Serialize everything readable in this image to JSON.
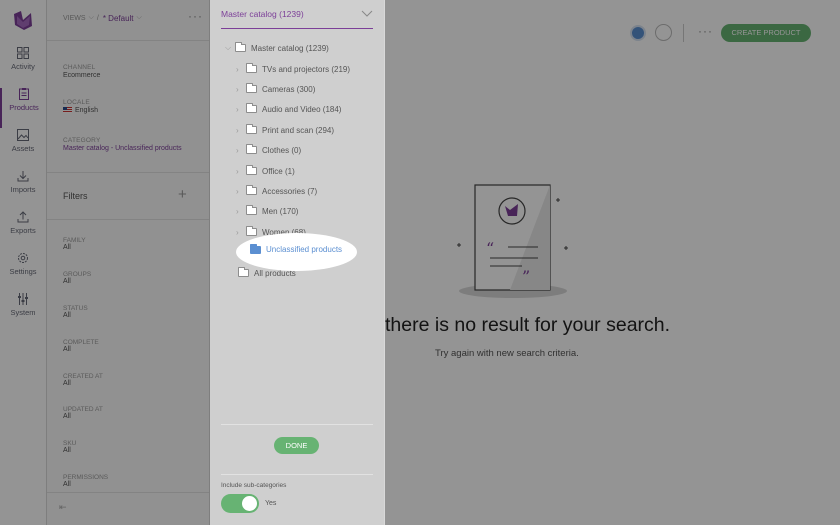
{
  "nav": {
    "items": [
      {
        "label": "Activity",
        "icon": "activity-icon"
      },
      {
        "label": "Products",
        "icon": "products-icon",
        "active": true
      },
      {
        "label": "Assets",
        "icon": "assets-icon"
      },
      {
        "label": "Imports",
        "icon": "imports-icon"
      },
      {
        "label": "Exports",
        "icon": "exports-icon"
      },
      {
        "label": "Settings",
        "icon": "settings-icon"
      },
      {
        "label": "System",
        "icon": "system-icon"
      }
    ]
  },
  "views": {
    "label": "VIEWS",
    "separator": "/",
    "selected": "* Default"
  },
  "context": {
    "channel": {
      "label": "CHANNEL",
      "value": "Ecommerce"
    },
    "locale": {
      "label": "LOCALE",
      "value": "English"
    },
    "category": {
      "label": "CATEGORY",
      "value": "Master catalog - Unclassified products"
    }
  },
  "filters": {
    "title": "Filters",
    "add": "+",
    "items": [
      {
        "label": "FAMILY",
        "value": "All"
      },
      {
        "label": "GROUPS",
        "value": "All"
      },
      {
        "label": "STATUS",
        "value": "All"
      },
      {
        "label": "COMPLETE",
        "value": "All"
      },
      {
        "label": "CREATED AT",
        "value": "All"
      },
      {
        "label": "UPDATED AT",
        "value": "All"
      },
      {
        "label": "SKU",
        "value": "All"
      },
      {
        "label": "PERMISSIONS",
        "value": "All"
      }
    ]
  },
  "tree": {
    "selector": "Master catalog (1239)",
    "root": "Master catalog (1239)",
    "children": [
      "TVs and projectors (219)",
      "Cameras (300)",
      "Audio and Video (184)",
      "Print and scan (294)",
      "Clothes (0)",
      "Office (1)",
      "Accessories (7)",
      "Men (170)",
      "Women (68)"
    ],
    "selected": "Unclassified products",
    "all_products": "All products",
    "done": "DONE",
    "include_sub_label": "Include sub-categories",
    "include_sub_value": "Yes"
  },
  "main": {
    "create_button": "CREATE PRODUCT",
    "empty_title": "there is no result for your search.",
    "empty_subtitle": "Try again with new search criteria."
  },
  "colors": {
    "accent": "#7c3f98",
    "button_green": "#67b373",
    "folder_blue": "#5b8fd1"
  }
}
